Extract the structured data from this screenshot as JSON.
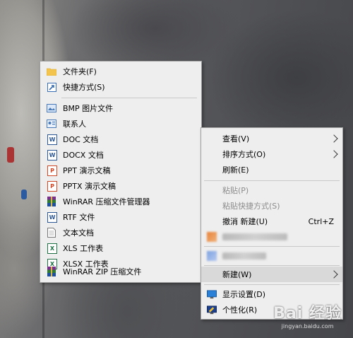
{
  "new_submenu": {
    "items": [
      {
        "label": "文件夹(F)",
        "icon": "folder-icon"
      },
      {
        "label": "快捷方式(S)",
        "icon": "shortcut-icon"
      },
      {
        "label": "BMP 图片文件",
        "icon": "bmp-file-icon"
      },
      {
        "label": "联系人",
        "icon": "contact-icon"
      },
      {
        "label": "DOC 文档",
        "icon": "doc-file-icon"
      },
      {
        "label": "DOCX 文档",
        "icon": "docx-file-icon"
      },
      {
        "label": "PPT 演示文稿",
        "icon": "ppt-file-icon"
      },
      {
        "label": "PPTX 演示文稿",
        "icon": "pptx-file-icon"
      },
      {
        "label": "WinRAR 压缩文件管理器",
        "icon": "winrar-icon"
      },
      {
        "label": "RTF 文件",
        "icon": "rtf-file-icon"
      },
      {
        "label": "文本文档",
        "icon": "text-file-icon"
      },
      {
        "label": "XLS 工作表",
        "icon": "xls-file-icon"
      },
      {
        "label": "XLSX 工作表",
        "icon": "xlsx-file-icon"
      },
      {
        "label": "WinRAR ZIP 压缩文件",
        "icon": "winrar-zip-icon"
      }
    ],
    "icon_glyphs": {
      "doc": "W",
      "ppt": "P",
      "xls": "X",
      "rtf": "W"
    }
  },
  "desktop_menu": {
    "view": "查看(V)",
    "sort_by": "排序方式(O)",
    "refresh": "刷新(E)",
    "paste": "粘贴(P)",
    "paste_shortcut": "粘贴快捷方式(S)",
    "undo_new": "撤消 新建(U)",
    "undo_shortcut": "Ctrl+Z",
    "new": "新建(W)",
    "display_settings": "显示设置(D)",
    "personalize": "个性化(R)"
  },
  "watermark": {
    "brand": "Bai 经验",
    "url": "jingyan.baidu.com"
  },
  "colors": {
    "menu_bg": "#eeeeee",
    "highlight": "#d9d9d9",
    "disabled_text": "#8c8c8c",
    "folder": "#f3c54f",
    "word_blue": "#2b5797",
    "ppt_orange": "#d24726",
    "excel_green": "#1e7145"
  }
}
